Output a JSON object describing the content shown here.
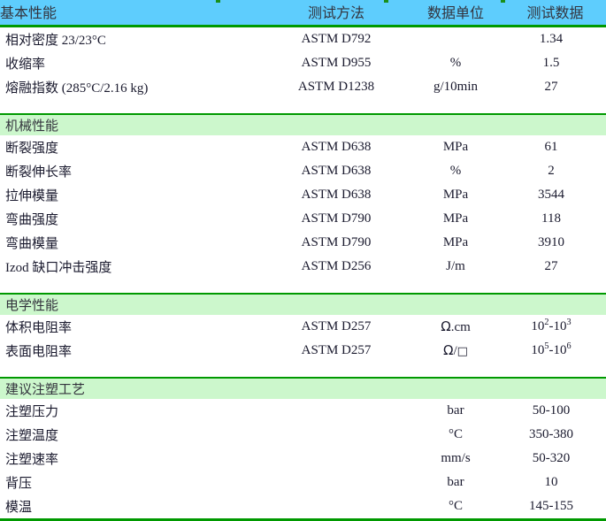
{
  "table": {
    "columns": {
      "property": "基本性能",
      "method": "测试方法",
      "unit": "数据单位",
      "value": "测试数据"
    },
    "colors": {
      "header_background": "#5ecdfd",
      "section_background": "#ccf7cc",
      "rule": "#009900",
      "text": "#33333d",
      "page_background": "#ffffff"
    },
    "sections": [
      {
        "title": "基本性能",
        "is_header_band": true,
        "rows": [
          {
            "property": "相对密度 23/23°C",
            "method": "ASTM D792",
            "unit": "",
            "value": "1.34"
          },
          {
            "property": "收缩率",
            "method": "ASTM D955",
            "unit": "%",
            "value": "1.5"
          },
          {
            "property": "熔融指数 (285°C/2.16 kg)",
            "method": "ASTM D1238",
            "unit": "g/10min",
            "value": "27"
          }
        ]
      },
      {
        "title": "机械性能",
        "is_header_band": false,
        "rows": [
          {
            "property": "断裂强度",
            "method": "ASTM D638",
            "unit": "MPa",
            "value": "61"
          },
          {
            "property": "断裂伸长率",
            "method": "ASTM D638",
            "unit": "%",
            "value": "2"
          },
          {
            "property": "拉伸模量",
            "method": "ASTM D638",
            "unit": "MPa",
            "value": "3544"
          },
          {
            "property": "弯曲强度",
            "method": "ASTM D790",
            "unit": "MPa",
            "value": "118"
          },
          {
            "property": "弯曲模量",
            "method": "ASTM D790",
            "unit": "MPa",
            "value": "3910"
          },
          {
            "property": "Izod 缺口冲击强度",
            "method": "ASTM D256",
            "unit": "J/m",
            "value": "27"
          }
        ]
      },
      {
        "title": "电学性能",
        "is_header_band": false,
        "rows": [
          {
            "property": "体积电阻率",
            "method": "ASTM D257",
            "unit": "Ω.cm",
            "value_html": "10<sup>2</sup>-10<sup>3</sup>",
            "value": "10^2-10^3"
          },
          {
            "property": "表面电阻率",
            "method": "ASTM D257",
            "unit": "Ω/□",
            "value_html": "10<sup>5</sup>-10<sup>6</sup>",
            "value": "10^5-10^6"
          }
        ]
      },
      {
        "title": "建议注塑工艺",
        "is_header_band": false,
        "rows": [
          {
            "property": "注塑压力",
            "method": "",
            "unit": "bar",
            "value": "50-100"
          },
          {
            "property": "注塑温度",
            "method": "",
            "unit": "°C",
            "value": "350-380"
          },
          {
            "property": "注塑速率",
            "method": "",
            "unit": "mm/s",
            "value": "50-320"
          },
          {
            "property": "背压",
            "method": "",
            "unit": "bar",
            "value": "10"
          },
          {
            "property": "模温",
            "method": "",
            "unit": "°C",
            "value": "145-155"
          }
        ]
      }
    ]
  }
}
